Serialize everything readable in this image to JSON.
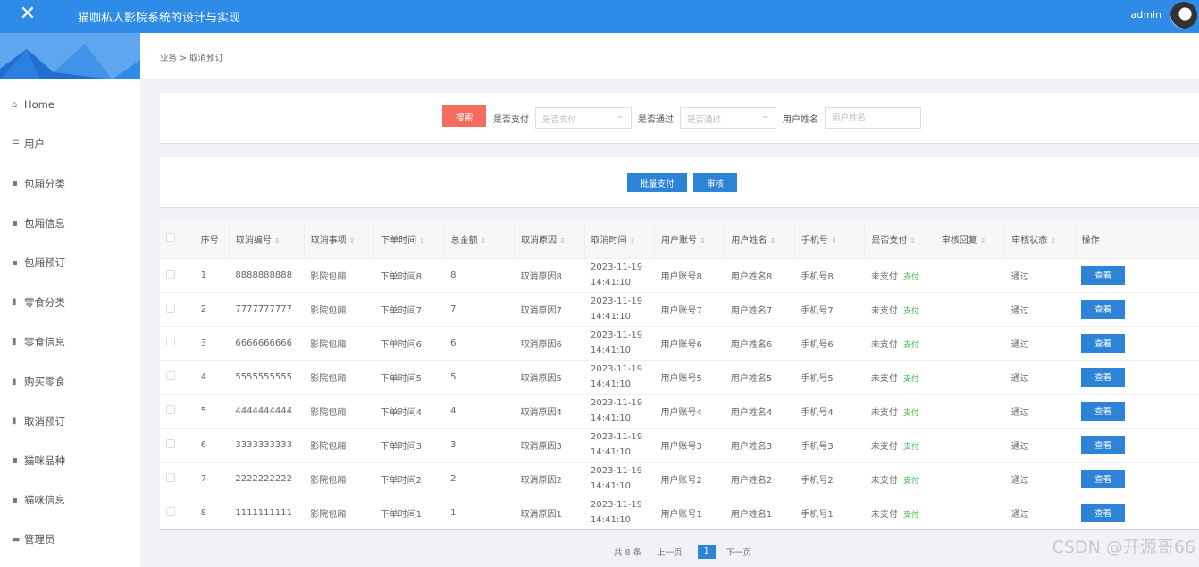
{
  "header": {
    "close_glyph": "✕",
    "title": "猫咖私人影院系统的设计与实现",
    "user": "admin"
  },
  "sidebar": {
    "items": [
      {
        "icon": "home-icon",
        "glyph": "⌂",
        "label": "Home"
      },
      {
        "icon": "list-icon",
        "glyph": "☰",
        "label": "用户"
      },
      {
        "icon": "grid-icon",
        "glyph": "▪",
        "label": "包厢分类"
      },
      {
        "icon": "grid-icon",
        "glyph": "▪",
        "label": "包厢信息"
      },
      {
        "icon": "grid-icon",
        "glyph": "▪",
        "label": "包厢预订"
      },
      {
        "icon": "chart-icon",
        "glyph": "▮",
        "label": "零食分类"
      },
      {
        "icon": "thumb-icon",
        "glyph": "▮",
        "label": "零食信息"
      },
      {
        "icon": "clipboard-icon",
        "glyph": "▮",
        "label": "购买零食"
      },
      {
        "icon": "bar-chart-icon",
        "glyph": "▮",
        "label": "取消预订"
      },
      {
        "icon": "grid-icon",
        "glyph": "▪",
        "label": "猫咪品种"
      },
      {
        "icon": "grid-icon",
        "glyph": "▪",
        "label": "猫咪信息"
      },
      {
        "icon": "monitor-icon",
        "glyph": "▬",
        "label": "管理员"
      }
    ]
  },
  "breadcrumb": "业务 > 取消预订",
  "search": {
    "button": "搜索",
    "paid_label": "是否支付",
    "paid_placeholder": "是否支付",
    "approved_label": "是否通过",
    "approved_placeholder": "是否通过",
    "name_label": "用户姓名",
    "name_placeholder": "用户姓名"
  },
  "actions": {
    "batch_pay": "批量支付",
    "review": "审核"
  },
  "table": {
    "headers": [
      "序号",
      "取消编号",
      "取消事项",
      "下单时间",
      "总金额",
      "取消原因",
      "取消时间",
      "用户账号",
      "用户姓名",
      "手机号",
      "是否支付",
      "审核回复",
      "审核状态",
      "操作"
    ],
    "rows": [
      {
        "no": "1",
        "code": "8888888888",
        "item": "影院包厢",
        "order_time": "下单时间8",
        "amount": "8",
        "reason": "取消原因8",
        "date": "2023-11-19",
        "time": "14:41:10",
        "account": "用户账号8",
        "name": "用户姓名8",
        "phone": "手机号8",
        "paid": "未支付",
        "pay": "支付",
        "reply": "",
        "status": "通过",
        "view": "查看"
      },
      {
        "no": "2",
        "code": "7777777777",
        "item": "影院包厢",
        "order_time": "下单时间7",
        "amount": "7",
        "reason": "取消原因7",
        "date": "2023-11-19",
        "time": "14:41:10",
        "account": "用户账号7",
        "name": "用户姓名7",
        "phone": "手机号7",
        "paid": "未支付",
        "pay": "支付",
        "reply": "",
        "status": "通过",
        "view": "查看"
      },
      {
        "no": "3",
        "code": "6666666666",
        "item": "影院包厢",
        "order_time": "下单时间6",
        "amount": "6",
        "reason": "取消原因6",
        "date": "2023-11-19",
        "time": "14:41:10",
        "account": "用户账号6",
        "name": "用户姓名6",
        "phone": "手机号6",
        "paid": "未支付",
        "pay": "支付",
        "reply": "",
        "status": "通过",
        "view": "查看"
      },
      {
        "no": "4",
        "code": "5555555555",
        "item": "影院包厢",
        "order_time": "下单时间5",
        "amount": "5",
        "reason": "取消原因5",
        "date": "2023-11-19",
        "time": "14:41:10",
        "account": "用户账号5",
        "name": "用户姓名5",
        "phone": "手机号5",
        "paid": "未支付",
        "pay": "支付",
        "reply": "",
        "status": "通过",
        "view": "查看"
      },
      {
        "no": "5",
        "code": "4444444444",
        "item": "影院包厢",
        "order_time": "下单时间4",
        "amount": "4",
        "reason": "取消原因4",
        "date": "2023-11-19",
        "time": "14:41:10",
        "account": "用户账号4",
        "name": "用户姓名4",
        "phone": "手机号4",
        "paid": "未支付",
        "pay": "支付",
        "reply": "",
        "status": "通过",
        "view": "查看"
      },
      {
        "no": "6",
        "code": "3333333333",
        "item": "影院包厢",
        "order_time": "下单时间3",
        "amount": "3",
        "reason": "取消原因3",
        "date": "2023-11-19",
        "time": "14:41:10",
        "account": "用户账号3",
        "name": "用户姓名3",
        "phone": "手机号3",
        "paid": "未支付",
        "pay": "支付",
        "reply": "",
        "status": "通过",
        "view": "查看"
      },
      {
        "no": "7",
        "code": "2222222222",
        "item": "影院包厢",
        "order_time": "下单时间2",
        "amount": "2",
        "reason": "取消原因2",
        "date": "2023-11-19",
        "time": "14:41:10",
        "account": "用户账号2",
        "name": "用户姓名2",
        "phone": "手机号2",
        "paid": "未支付",
        "pay": "支付",
        "reply": "",
        "status": "通过",
        "view": "查看"
      },
      {
        "no": "8",
        "code": "1111111111",
        "item": "影院包厢",
        "order_time": "下单时间1",
        "amount": "1",
        "reason": "取消原因1",
        "date": "2023-11-19",
        "time": "14:41:10",
        "account": "用户账号1",
        "name": "用户姓名1",
        "phone": "手机号1",
        "paid": "未支付",
        "pay": "支付",
        "reply": "",
        "status": "通过",
        "view": "查看"
      }
    ]
  },
  "pagination": {
    "total": "共 8 条",
    "prev": "上一页",
    "current": "1",
    "next": "下一页"
  },
  "watermark": "CSDN @开源哥66",
  "colors": {
    "primary": "#2f8be8",
    "search_button": "#f56c5c",
    "action_button": "#2d84d6",
    "pay_link": "#3ab54a"
  }
}
